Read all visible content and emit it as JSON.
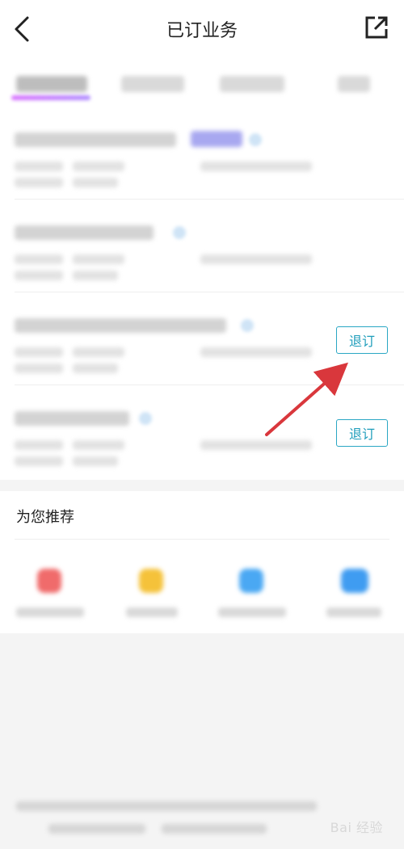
{
  "header": {
    "title": "已订业务",
    "back_icon": "chevron-left-icon",
    "share_icon": "external-share-icon"
  },
  "list": {
    "rows": [
      {
        "has_button": false
      },
      {
        "has_button": false
      },
      {
        "has_button": true,
        "button_label": "退订"
      },
      {
        "has_button": true,
        "button_label": "退订"
      }
    ]
  },
  "recommend": {
    "title": "为您推荐",
    "icon_colors": [
      "#f06b6b",
      "#f5c23a",
      "#4aa8f3",
      "#3f9cf1"
    ]
  },
  "watermark": "Bai 经验",
  "colors": {
    "accent": "#1e9dbb",
    "arrow": "#d9373c",
    "tab_underline": "#c37cff"
  }
}
